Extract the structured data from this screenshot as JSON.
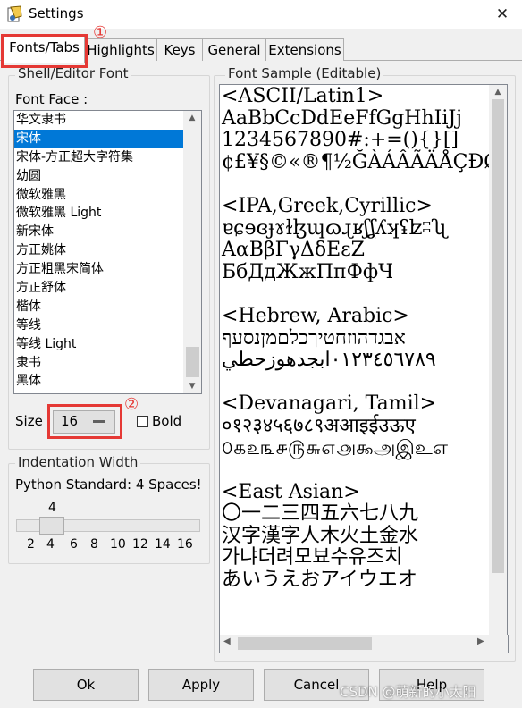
{
  "window": {
    "title": "Settings",
    "close_glyph": "✕"
  },
  "tabs": [
    "Fonts/Tabs",
    "Highlights",
    "Keys",
    "General",
    "Extensions"
  ],
  "annotations": {
    "mark1": "①",
    "mark2": "②"
  },
  "shell_font": {
    "group_label": "Shell/Editor Font",
    "font_face_label": "Font Face :",
    "fonts": [
      "华文隶书",
      "宋体",
      "宋体-方正超大字符集",
      "幼圆",
      "微软雅黑",
      "微软雅黑 Light",
      "新宋体",
      "方正姚体",
      "方正粗黑宋简体",
      "方正舒体",
      "楷体",
      "等线",
      "等线 Light",
      "隶书",
      "黑体"
    ],
    "selected_font": "宋体",
    "size_label": "Size :",
    "size_value": "16",
    "bold_label": "Bold",
    "bold_checked": false
  },
  "indentation": {
    "group_label": "Indentation Width",
    "python_standard": "Python Standard: 4 Spaces!",
    "slider_value": "4",
    "ticks": [
      "2",
      "4",
      "6",
      "8",
      "10",
      "12",
      "14",
      "16"
    ]
  },
  "sample": {
    "label": "Font Sample (Editable)",
    "lines": [
      "<ASCII/Latin1>",
      "AaBbCcDdEeFfGgHhIiJj",
      "1234567890#:+=(){}[]",
      "¢£¥§©«®¶½ĞÀÁÂÃÄÅÇÐØß",
      "",
      "<IPA,Greek,Cyrillic>",
      "ɐɕɘɞɟɤɫɮɰɷɻʁʃʆʎʞʢʫʭʯ",
      "ΑαΒβΓγΔδΕεΖ",
      "БбДдЖжПпФфЧ",
      "",
      "<Hebrew, Arabic>",
      "אבגדהוזחטיךכלםמןנסעף",
      "٠١٢٣٤٥٦٧٨٩ابجدهوزحطي",
      "",
      "<Devanagari, Tamil>",
      "०१२३४५६७८९अआइईउऊए",
      "௦௧௨௩௪௫௬௭௮௯அஇஉஎ",
      "",
      "<East Asian>",
      "〇一二三四五六七八九",
      "汉字漢字人木火土金水",
      "가냐더려모뵤수유즈치",
      "あいうえおアイウエオ"
    ]
  },
  "buttons": {
    "ok": "Ok",
    "apply": "Apply",
    "cancel": "Cancel",
    "help": "Help"
  },
  "watermark": "CSDN @萌新的小太阳"
}
